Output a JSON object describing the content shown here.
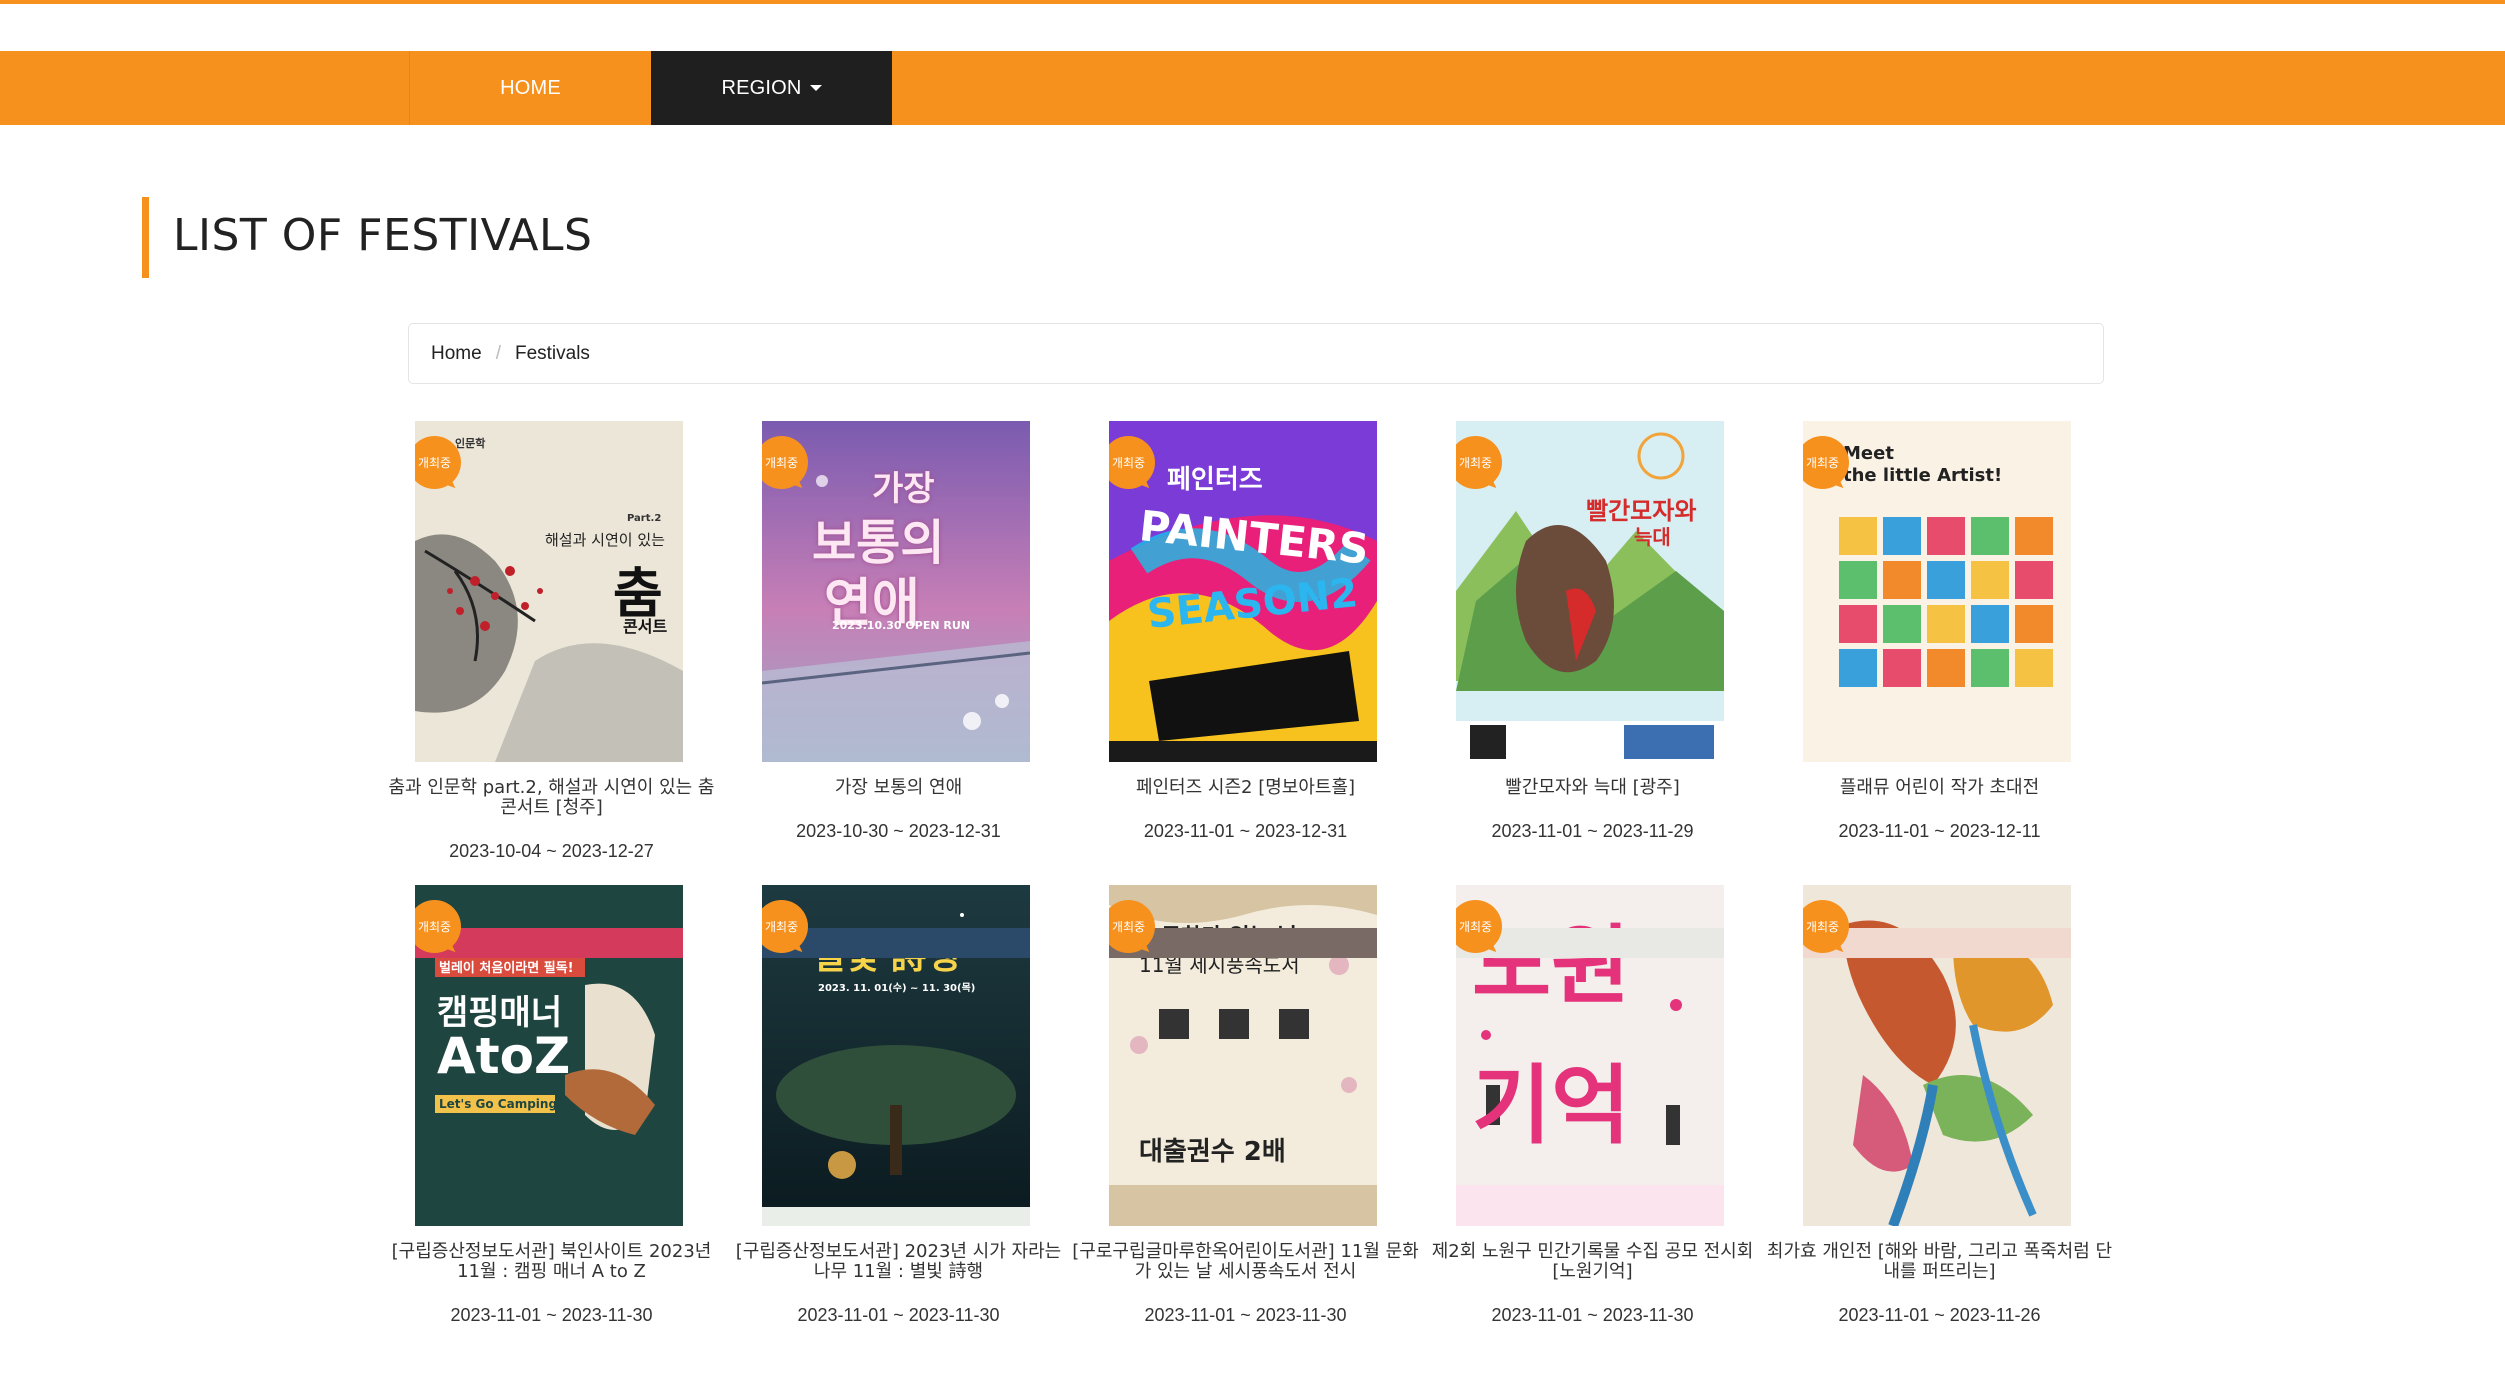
{
  "nav": {
    "home": "HOME",
    "region": "REGION"
  },
  "page_title": "LIST OF FESTIVALS",
  "breadcrumb": {
    "home": "Home",
    "current": "Festivals"
  },
  "badge_label": "개최중",
  "colors": {
    "accent": "#f7911e",
    "nav_active": "#1f1f1f"
  },
  "festivals": [
    {
      "title": "춤과 인문학 part.2, 해설과 시연이 있는 춤 콘서트 [청주]",
      "date": "2023-10-04 ~ 2023-12-27",
      "poster_text": [
        "인문학",
        "Part.2",
        "해설과 시연이 있는",
        "춤",
        "콘서트"
      ]
    },
    {
      "title": "가장 보통의 연애",
      "date": "2023-10-30 ~ 2023-12-31",
      "poster_text": [
        "가장",
        "보통의",
        "연애",
        "2023.10.30 OPEN RUN"
      ]
    },
    {
      "title": "페인터즈 시즌2 [명보아트홀]",
      "date": "2023-11-01 ~ 2023-12-31",
      "poster_text": [
        "페인터즈",
        "PAINTERS",
        "SEASON2"
      ]
    },
    {
      "title": "빨간모자와 늑대 [광주]",
      "date": "2023-11-01 ~ 2023-11-29",
      "poster_text": [
        "빨간모자와",
        "늑대"
      ]
    },
    {
      "title": "플래뮤 어린이 작가 초대전",
      "date": "2023-11-01 ~ 2023-12-11",
      "poster_text": [
        "Meet",
        "the little Artist!"
      ]
    },
    {
      "title": "[구립증산정보도서관] 북인사이트 2023년 11월 : 캠핑 매너 A to Z",
      "date": "2023-11-01 ~ 2023-11-30",
      "poster_text": [
        "캠핑매너",
        "AtoZ",
        "Let's Go Camping!"
      ]
    },
    {
      "title": "[구립증산정보도서관] 2023년 시가 자라는 나무 11월 : 별빛 詩행",
      "date": "2023-11-01 ~ 2023-11-30",
      "poster_text": [
        "별빛 詩행",
        "2023. 11. 01(수) ~ 11. 30(목)"
      ]
    },
    {
      "title": "[구로구립글마루한옥어린이도서관] 11월 문화가 있는 날 세시풍속도서 전시",
      "date": "2023-11-01 ~ 2023-11-30",
      "poster_text": [
        "문화가 있는 날",
        "11월 세시풍속도서",
        "대출권수 2배"
      ]
    },
    {
      "title": "제2회 노원구 민간기록물 수집 공모 전시회 [노원기억]",
      "date": "2023-11-01 ~ 2023-11-30",
      "poster_text": [
        "노원",
        "기억"
      ]
    },
    {
      "title": "최가효 개인전 [해와 바람, 그리고 폭죽처럼 단내를 퍼뜨리는]",
      "date": "2023-11-01 ~ 2023-11-26",
      "poster_text": []
    }
  ]
}
